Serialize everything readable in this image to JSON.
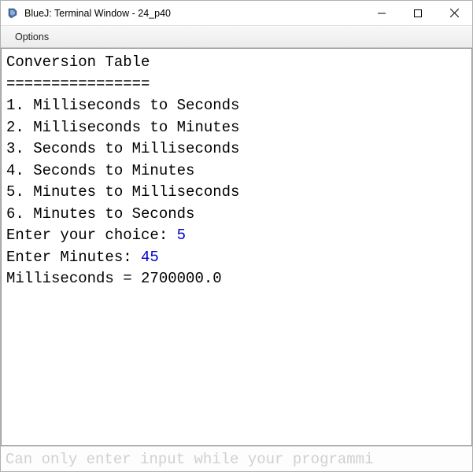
{
  "window": {
    "title": "BlueJ: Terminal Window - 24_p40"
  },
  "menubar": {
    "options_label": "Options"
  },
  "terminal": {
    "header": "Conversion Table",
    "divider": "================",
    "lines": {
      "l1": "1. Milliseconds to Seconds",
      "l2": "2. Milliseconds to Minutes",
      "l3": "3. Seconds to Milliseconds",
      "l4": "4. Seconds to Minutes",
      "l5": "5. Minutes to Milliseconds",
      "l6": "6. Minutes to Seconds"
    },
    "prompt1_label": "Enter your choice: ",
    "prompt1_value": "5",
    "prompt2_label": "Enter Minutes: ",
    "prompt2_value": "45",
    "result": "Milliseconds = 2700000.0"
  },
  "input_bar": {
    "placeholder": "Can only enter input while your programmi"
  }
}
